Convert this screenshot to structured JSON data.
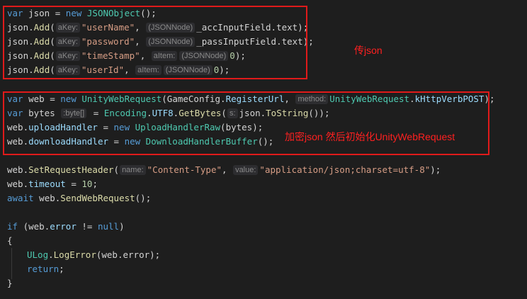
{
  "annotations": {
    "box1_note": "传json",
    "box2_note": "加密json 然后初始化UnityWebRequest"
  },
  "code": {
    "l1": {
      "kw1": "var",
      "v": " json = ",
      "kw2": "new",
      "ty": " JSONObject",
      "rest": "();"
    },
    "l2": {
      "obj": "json.",
      "fn": "Add",
      "p": "(",
      "h1": "aKey:",
      "str": "\"userName\"",
      "c": ", ",
      "h2": "(JSONNode)",
      "rest": "_accInputField.text);"
    },
    "l3": {
      "obj": "json.",
      "fn": "Add",
      "p": "(",
      "h1": "aKey:",
      "str": "\"password\"",
      "c": ", ",
      "h2": "(JSONNode)",
      "rest": "_passInputField.text);"
    },
    "l4": {
      "obj": "json.",
      "fn": "Add",
      "p": "(",
      "h1": "aKey:",
      "str": "\"timeStamp\"",
      "c": ", ",
      "h2": "aItem:",
      "h3": "(JSONNode)",
      "num": "0",
      "rest": ");"
    },
    "l5": {
      "obj": "json.",
      "fn": "Add",
      "p": "(",
      "h1": "aKey:",
      "str": "\"userId\"",
      "c": ", ",
      "h2": "aItem:",
      "h3": "(JSONNode)",
      "num": "0",
      "rest": ");"
    },
    "l6": {
      "kw1": "var",
      "v": " web = ",
      "kw2": "new",
      "ty": " UnityWebRequest",
      "p": "(GameConfig.",
      "prop": "RegisterUrl",
      "c": ", ",
      "h1": "method:",
      "ty2": "UnityWebRequest",
      "dot": ".",
      "prop2": "kHttpVerbPOST",
      "rest": ");"
    },
    "l7": {
      "kw1": "var",
      "v": " bytes ",
      "h1": ":byte[]",
      "eq": " = ",
      "ty": "Encoding",
      "dot": ".",
      "prop": "UTF8",
      "dot2": ".",
      "fn": "GetBytes",
      "p": "(",
      "h2": "s:",
      "v2": "json.",
      "fn2": "ToString",
      "rest": "());"
    },
    "l8": {
      "v": "web.",
      "prop": "uploadHandler",
      "eq": " = ",
      "kw": "new",
      "ty": " UploadHandlerRaw",
      "rest": "(bytes);"
    },
    "l9": {
      "v": "web.",
      "prop": "downloadHandler",
      "eq": " = ",
      "kw": "new",
      "ty": " DownloadHandlerBuffer",
      "rest": "();"
    },
    "l10": {
      "v": "web.",
      "fn": "SetRequestHeader",
      "p": "(",
      "h1": "name:",
      "str": "\"Content-Type\"",
      "c": ", ",
      "h2": "value:",
      "str2": "\"application/json;charset=utf-8\"",
      "rest": ");"
    },
    "l11": {
      "v": "web.",
      "prop": "timeout",
      "eq": " = ",
      "num": "10",
      "rest": ";"
    },
    "l12": {
      "kw": "await",
      "v": " web.",
      "fn": "SendWebRequest",
      "rest": "();"
    },
    "l13": {
      "kw": "if",
      "v": " (web.",
      "prop": "error",
      "op": " != ",
      "kw2": "null",
      "rest": ")"
    },
    "l14": {
      "t": "{"
    },
    "l15": {
      "ty": "ULog",
      "dot": ".",
      "fn": "LogError",
      "rest": "(web.error);"
    },
    "l16": {
      "kw": "return",
      "rest": ";"
    },
    "l17": {
      "t": "}"
    }
  }
}
